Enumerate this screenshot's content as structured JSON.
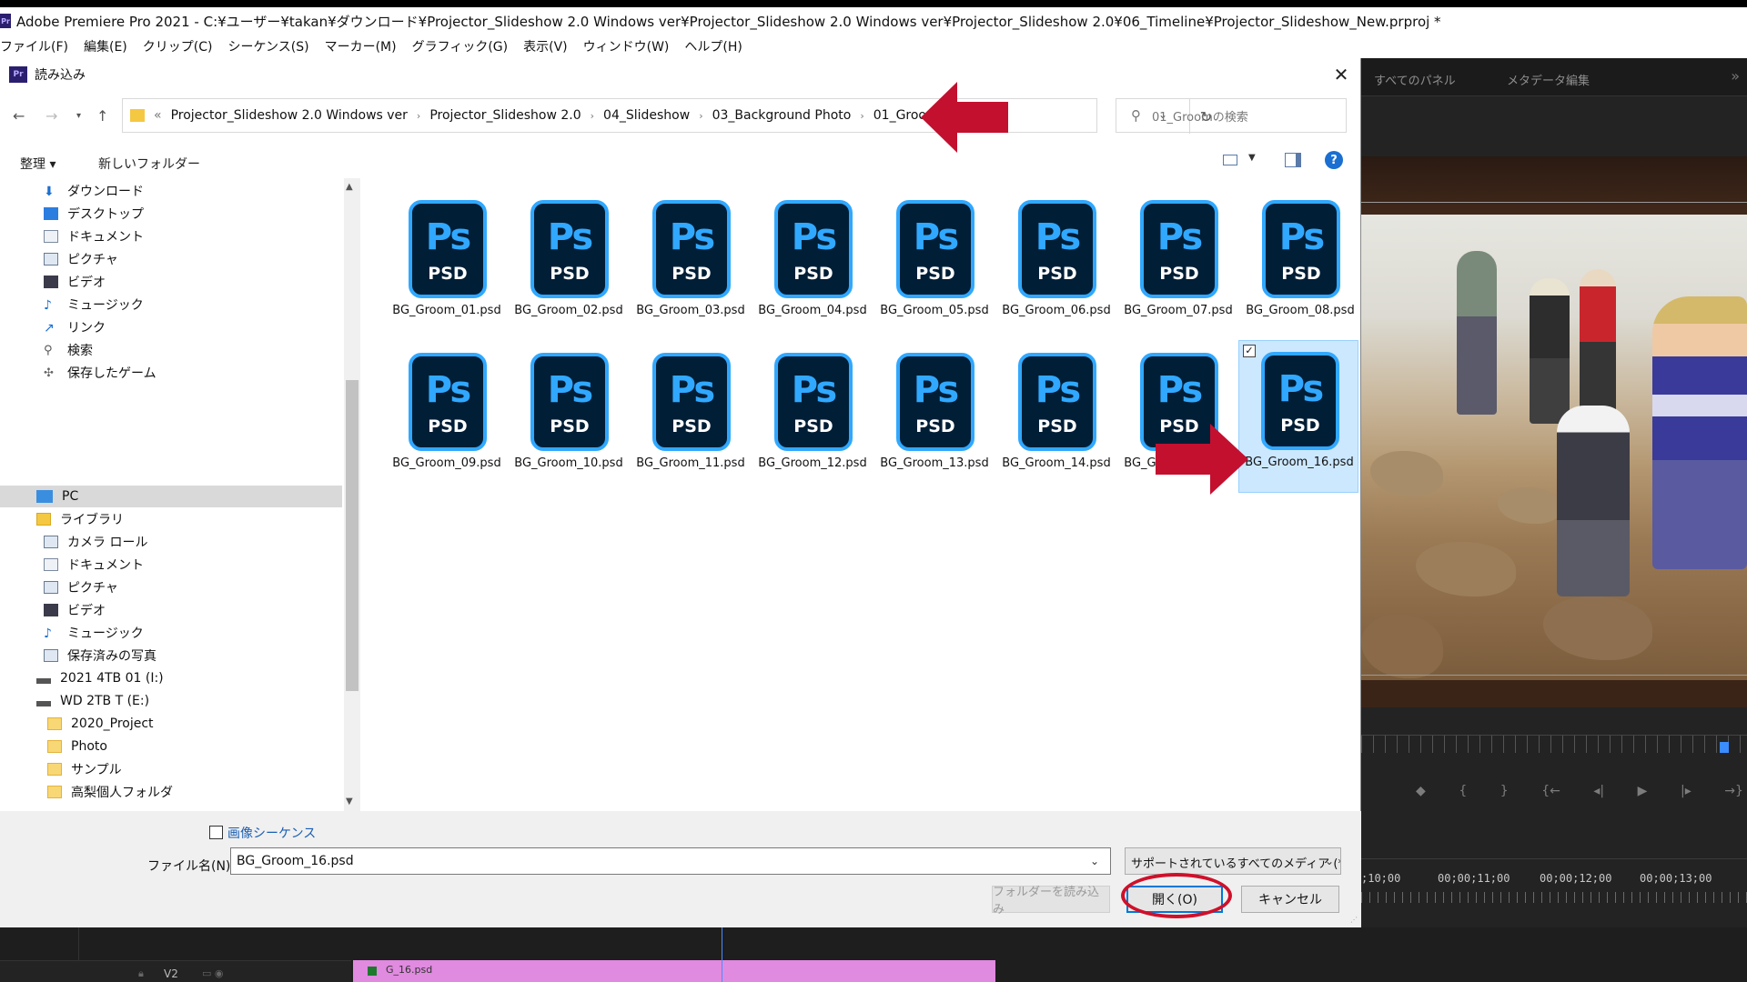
{
  "window": {
    "title": "Adobe Premiere Pro 2021 - C:¥ユーザー¥takan¥ダウンロード¥Projector_Slideshow 2.0 Windows ver¥Projector_Slideshow 2.0 Windows ver¥Projector_Slideshow 2.0¥06_Timeline¥Projector_Slideshow_New.prproj *",
    "logo": "Pr"
  },
  "menu": [
    "ファイル(F)",
    "編集(E)",
    "クリップ(C)",
    "シーケンス(S)",
    "マーカー(M)",
    "グラフィック(G)",
    "表示(V)",
    "ウィンドウ(W)",
    "ヘルプ(H)"
  ],
  "right_panel": {
    "tabs": [
      "すべてのパネル",
      "メタデータ編集"
    ],
    "more": "»",
    "timecodes": [
      ";10;00",
      "00;00;11;00",
      "00;00;12;00",
      "00;00;13;00"
    ]
  },
  "timeline": {
    "track": "V2",
    "clip": "G_16.psd"
  },
  "dialog": {
    "icon": "Pr",
    "title": "読み込み",
    "close": "✕",
    "breadcrumb_more": "«",
    "breadcrumbs": [
      "Projector_Slideshow 2.0 Windows ver",
      "Projector_Slideshow 2.0",
      "04_Slideshow",
      "03_Background Photo",
      "01_Groom"
    ],
    "search_placeholder": "01_Groomの検索",
    "organize": "整理 ▾",
    "new_folder": "新しいフォルダー",
    "help": "?",
    "nav_items": [
      {
        "label": "ダウンロード",
        "icon": "download-icon"
      },
      {
        "label": "デスクトップ",
        "icon": "desktop-icon"
      },
      {
        "label": "ドキュメント",
        "icon": "documents-icon"
      },
      {
        "label": "ピクチャ",
        "icon": "pictures-icon"
      },
      {
        "label": "ビデオ",
        "icon": "videos-icon"
      },
      {
        "label": "ミュージック",
        "icon": "music-icon"
      },
      {
        "label": "リンク",
        "icon": "links-icon"
      },
      {
        "label": "検索",
        "icon": "search-icon"
      },
      {
        "label": "保存したゲーム",
        "icon": "saved-games-icon"
      },
      {
        "label": "PC",
        "icon": "pc-icon"
      },
      {
        "label": "ライブラリ",
        "icon": "library-icon"
      },
      {
        "label": "カメラ ロール",
        "icon": "camera-roll-icon"
      },
      {
        "label": "ドキュメント",
        "icon": "documents-icon"
      },
      {
        "label": "ピクチャ",
        "icon": "pictures-icon"
      },
      {
        "label": "ビデオ",
        "icon": "videos-icon"
      },
      {
        "label": "ミュージック",
        "icon": "music-icon"
      },
      {
        "label": "保存済みの写真",
        "icon": "saved-photos-icon"
      },
      {
        "label": "2021 4TB 01 (I:)",
        "icon": "drive-icon"
      },
      {
        "label": "WD 2TB T (E:)",
        "icon": "drive-icon"
      },
      {
        "label": "2020_Project",
        "icon": "folder-icon"
      },
      {
        "label": "Photo",
        "icon": "folder-icon"
      },
      {
        "label": "サンプル",
        "icon": "folder-icon"
      },
      {
        "label": "高梨個人フォルダ",
        "icon": "folder-icon"
      }
    ],
    "files": [
      {
        "name": "BG_Groom_01.psd"
      },
      {
        "name": "BG_Groom_02.psd"
      },
      {
        "name": "BG_Groom_03.psd"
      },
      {
        "name": "BG_Groom_04.psd"
      },
      {
        "name": "BG_Groom_05.psd"
      },
      {
        "name": "BG_Groom_06.psd"
      },
      {
        "name": "BG_Groom_07.psd"
      },
      {
        "name": "BG_Groom_08.psd"
      },
      {
        "name": "BG_Groom_09.psd"
      },
      {
        "name": "BG_Groom_10.psd"
      },
      {
        "name": "BG_Groom_11.psd"
      },
      {
        "name": "BG_Groom_12.psd"
      },
      {
        "name": "BG_Groom_13.psd"
      },
      {
        "name": "BG_Groom_14.psd"
      },
      {
        "name": "BG_Groom_15.psd"
      },
      {
        "name": "BG_Groom_16.psd",
        "selected": true
      }
    ],
    "ps_icon": {
      "ps": "Ps",
      "psd": "PSD",
      "bg": "#001e36",
      "accent": "#31a8ff"
    },
    "image_sequence_label": "画像シーケンス",
    "filename_label": "ファイル名(N):",
    "filename_value": "BG_Groom_16.psd",
    "file_type": "サポートされているすべてのメディア (*",
    "import_folder_button": "フォルダーを読み込み",
    "open_button": "開く(O)",
    "cancel_button": "キャンセル"
  },
  "annotation_color": "#d0102a"
}
